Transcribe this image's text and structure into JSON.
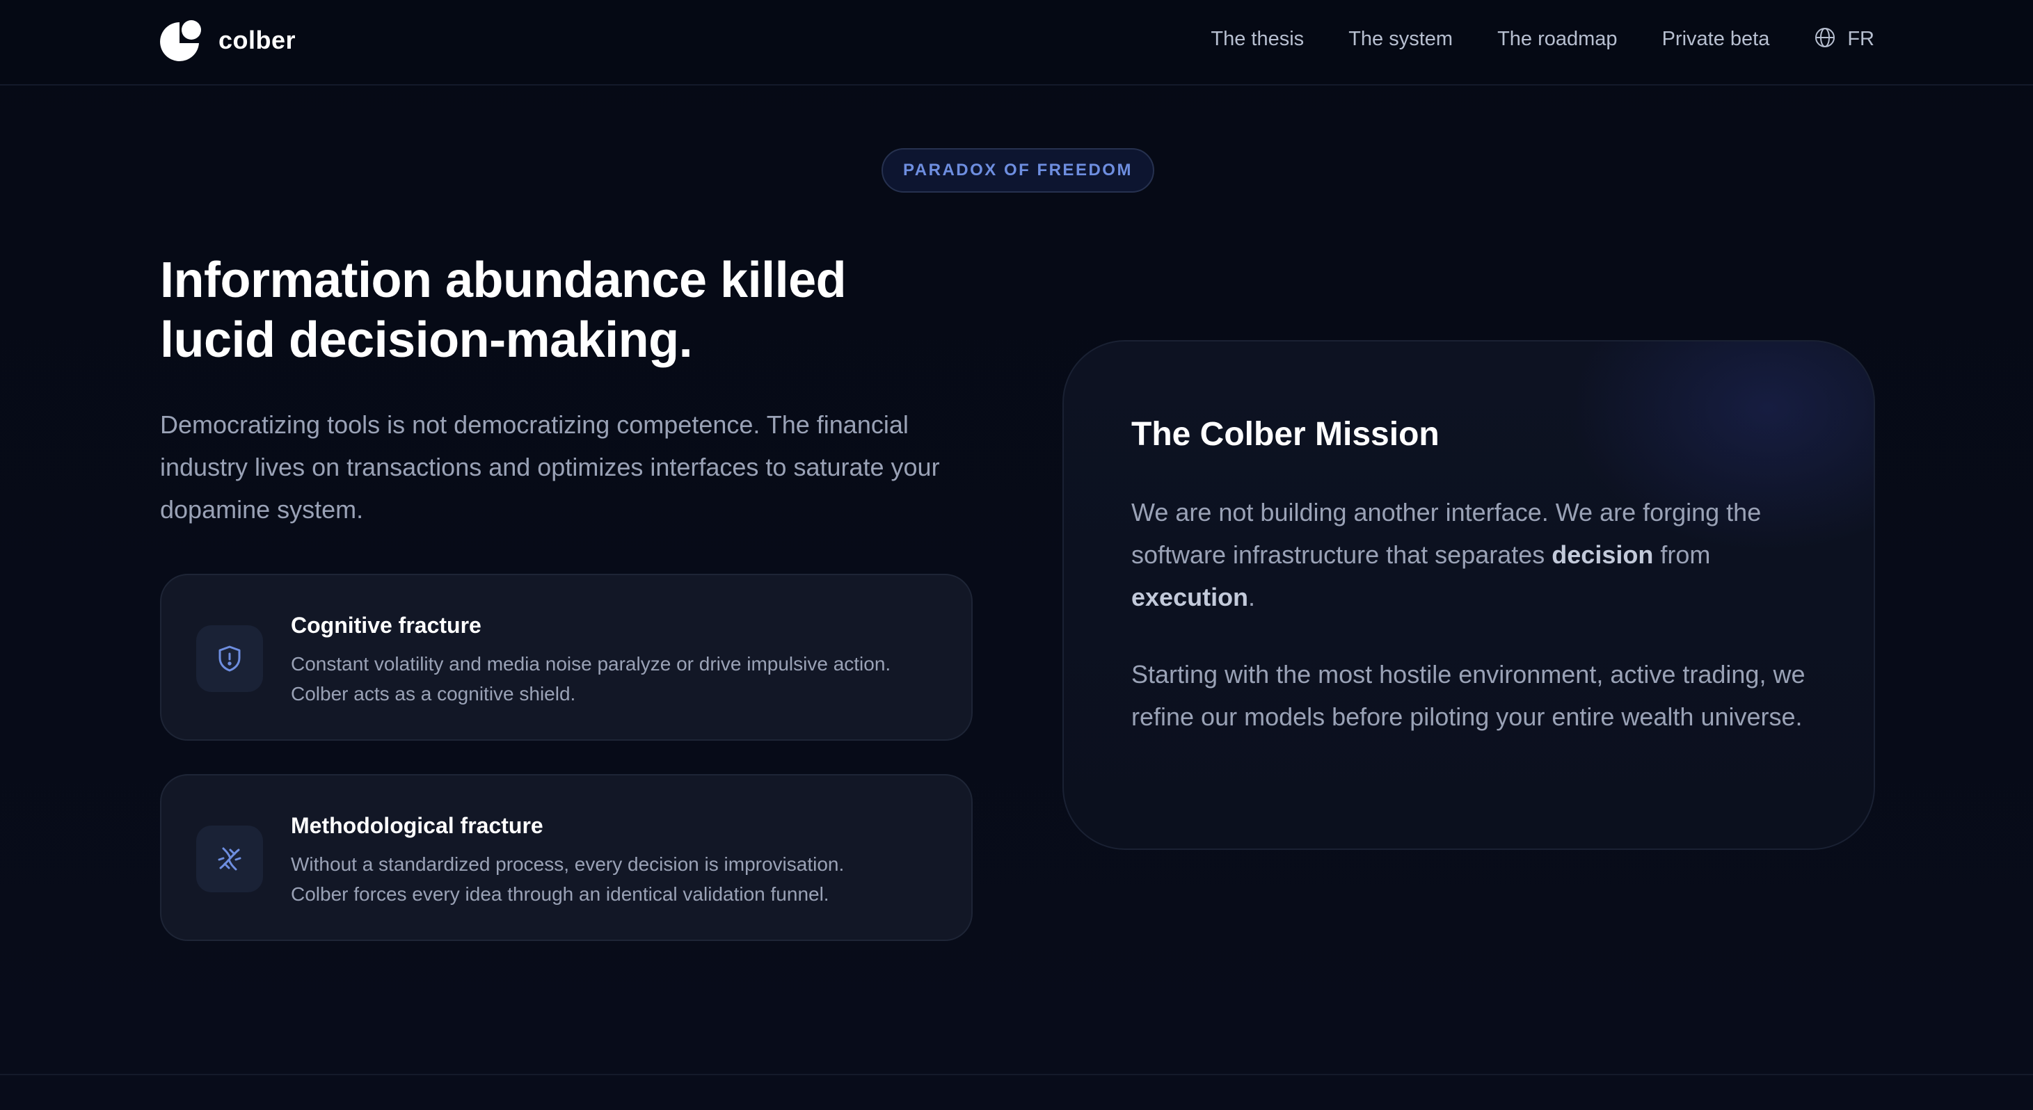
{
  "header": {
    "logo_text": "colber",
    "nav": [
      {
        "label": "The thesis"
      },
      {
        "label": "The system"
      },
      {
        "label": "The roadmap"
      },
      {
        "label": "Private beta"
      }
    ],
    "lang_label": "FR",
    "lang_icon": "globe-icon"
  },
  "badge": {
    "text": "PARADOX OF FREEDOM"
  },
  "hero": {
    "headline_line1": "Information abundance killed",
    "headline_line2": "lucid decision-making.",
    "lead": "Democratizing tools is not democratizing competence. The financial industry lives on transactions and optimizes interfaces to saturate your dopamine system."
  },
  "features": [
    {
      "icon": "shield-alert-icon",
      "title": "Cognitive fracture",
      "body_line1": "Constant volatility and media noise paralyze or drive impulsive action.",
      "body_line2": "Colber acts as a cognitive shield."
    },
    {
      "icon": "dna-icon",
      "title": "Methodological fracture",
      "body_line1": "Without a standardized process, every decision is improvisation.",
      "body_line2": "Colber forces every idea through an identical validation funnel."
    }
  ],
  "mission": {
    "title": "The Colber Mission",
    "p1_part1": "We are not building another interface. We are forging the software infrastructure that separates",
    "p1_bold1": "decision",
    "p1_part2": "from",
    "p1_bold2": "execution",
    "p1_part3": ".",
    "p2": "Starting with the most hostile environment, active trading, we refine our models before piloting your entire wealth universe."
  },
  "colors": {
    "background": "#070b17",
    "accent": "#6e8ee0",
    "muted_text": "#9aa2b6",
    "card_bg": "#121726"
  }
}
